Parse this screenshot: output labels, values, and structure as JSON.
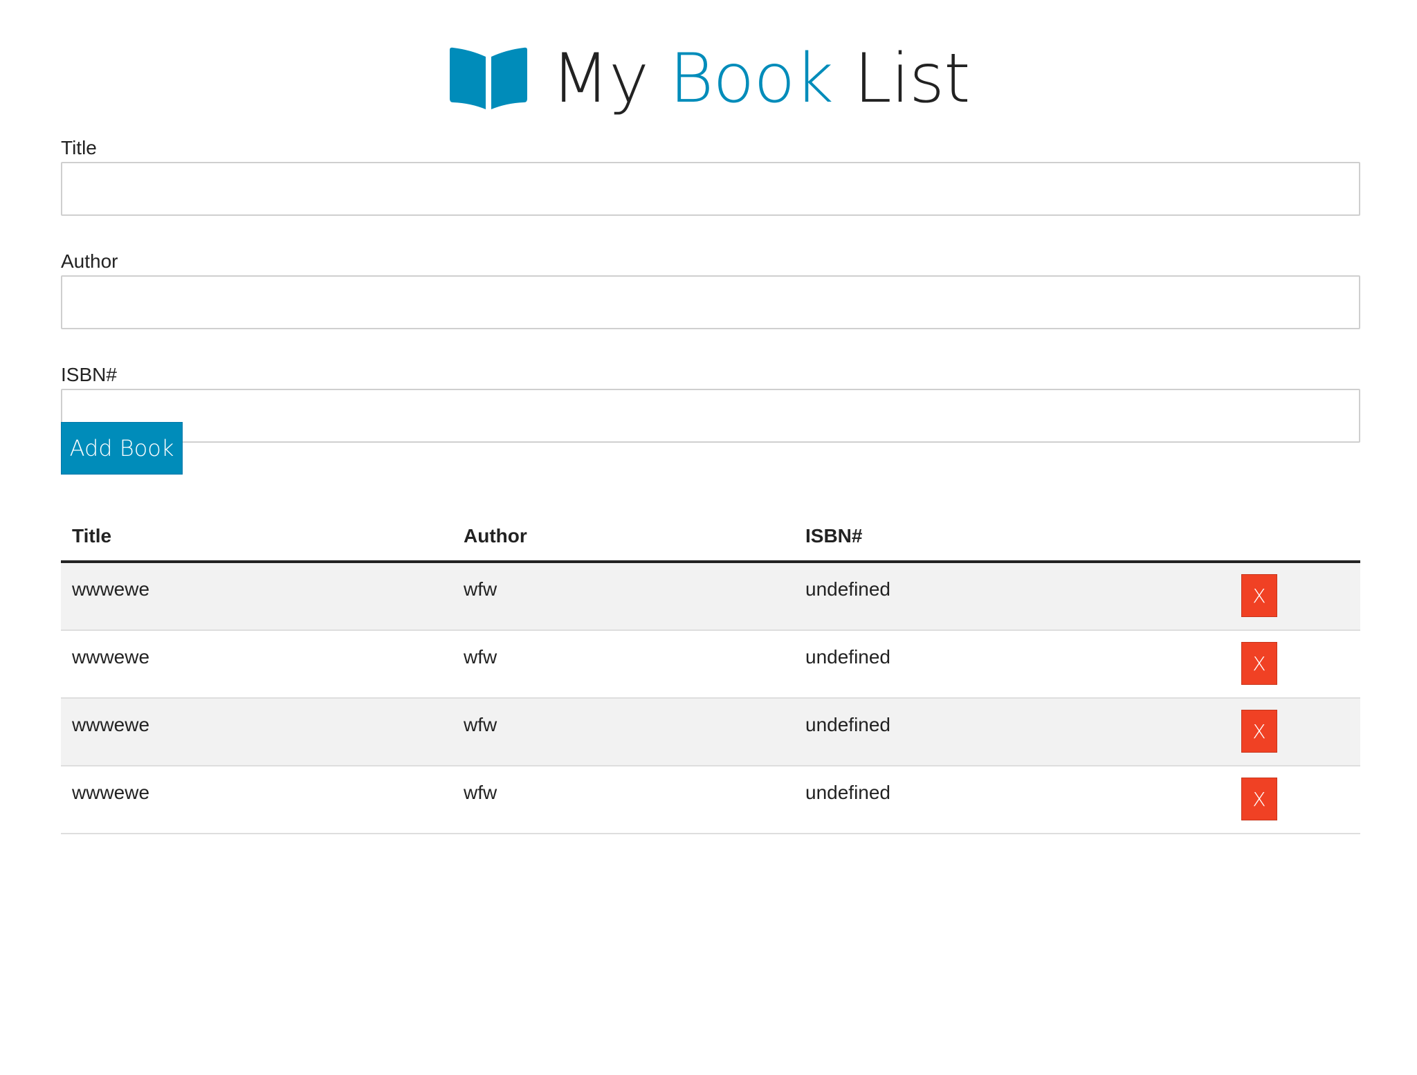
{
  "app": {
    "title_part1": "My ",
    "title_accent": "Book",
    "title_part3": " List",
    "logo_icon": "book-open-icon"
  },
  "colors": {
    "accent": "#008cba",
    "danger": "#f04124",
    "row_stripe": "#f2f2f2"
  },
  "form": {
    "title_label": "Title",
    "title_value": "",
    "author_label": "Author",
    "author_value": "",
    "isbn_label": "ISBN#",
    "isbn_value": "",
    "submit_label": "Add Book"
  },
  "table": {
    "headers": [
      "Title",
      "Author",
      "ISBN#",
      ""
    ],
    "delete_label": "X",
    "rows": [
      {
        "title": "wwwewe",
        "author": "wfw",
        "isbn": "undefined"
      },
      {
        "title": "wwwewe",
        "author": "wfw",
        "isbn": "undefined"
      },
      {
        "title": "wwwewe",
        "author": "wfw",
        "isbn": "undefined"
      },
      {
        "title": "wwwewe",
        "author": "wfw",
        "isbn": "undefined"
      }
    ]
  }
}
